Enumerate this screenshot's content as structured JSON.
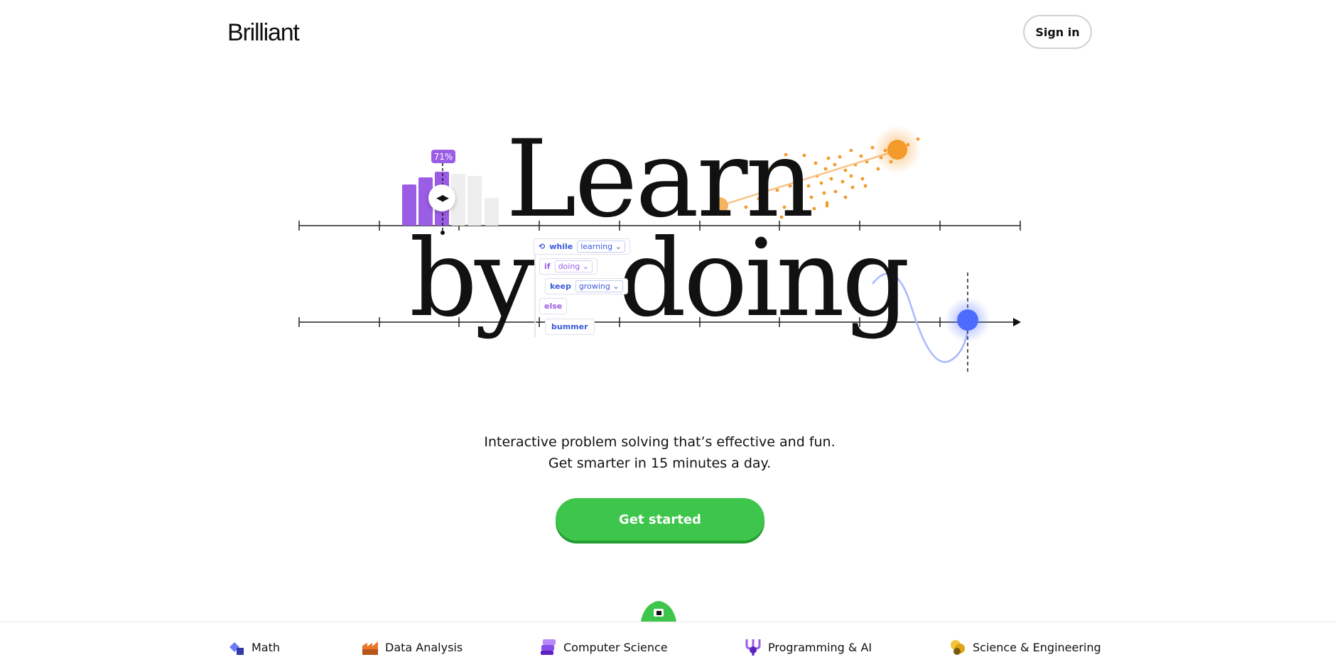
{
  "header": {
    "logo_text": "Brilliant",
    "signin_label": "Sign in"
  },
  "hero": {
    "headline_line1": "Learn",
    "headline_line2_a": "by",
    "headline_line2_b": "doing",
    "bar_widget": {
      "percent_label": "71%",
      "value": 0.71
    },
    "code_widget": {
      "while_kw": "while",
      "while_arg": "learning",
      "if_kw": "if",
      "if_arg": "doing",
      "keep_kw": "keep",
      "keep_arg": "growing",
      "else_kw": "else",
      "bummer_kw": "bummer"
    }
  },
  "tagline": {
    "line1": "Interactive problem solving that’s effective and fun.",
    "line2": "Get smarter in 15 minutes a day."
  },
  "cta": {
    "label": "Get started"
  },
  "categories": [
    {
      "label": "Math",
      "icon": "math-icon"
    },
    {
      "label": "Data Analysis",
      "icon": "data-analysis-icon"
    },
    {
      "label": "Computer Science",
      "icon": "computer-science-icon"
    },
    {
      "label": "Programming & AI",
      "icon": "programming-ai-icon"
    },
    {
      "label": "Science & Engineering",
      "icon": "science-engineering-icon"
    }
  ],
  "colors": {
    "accent_green": "#3ec54b",
    "purple": "#9b5de5",
    "orange": "#f39a2a",
    "blue": "#4d6bfe"
  }
}
